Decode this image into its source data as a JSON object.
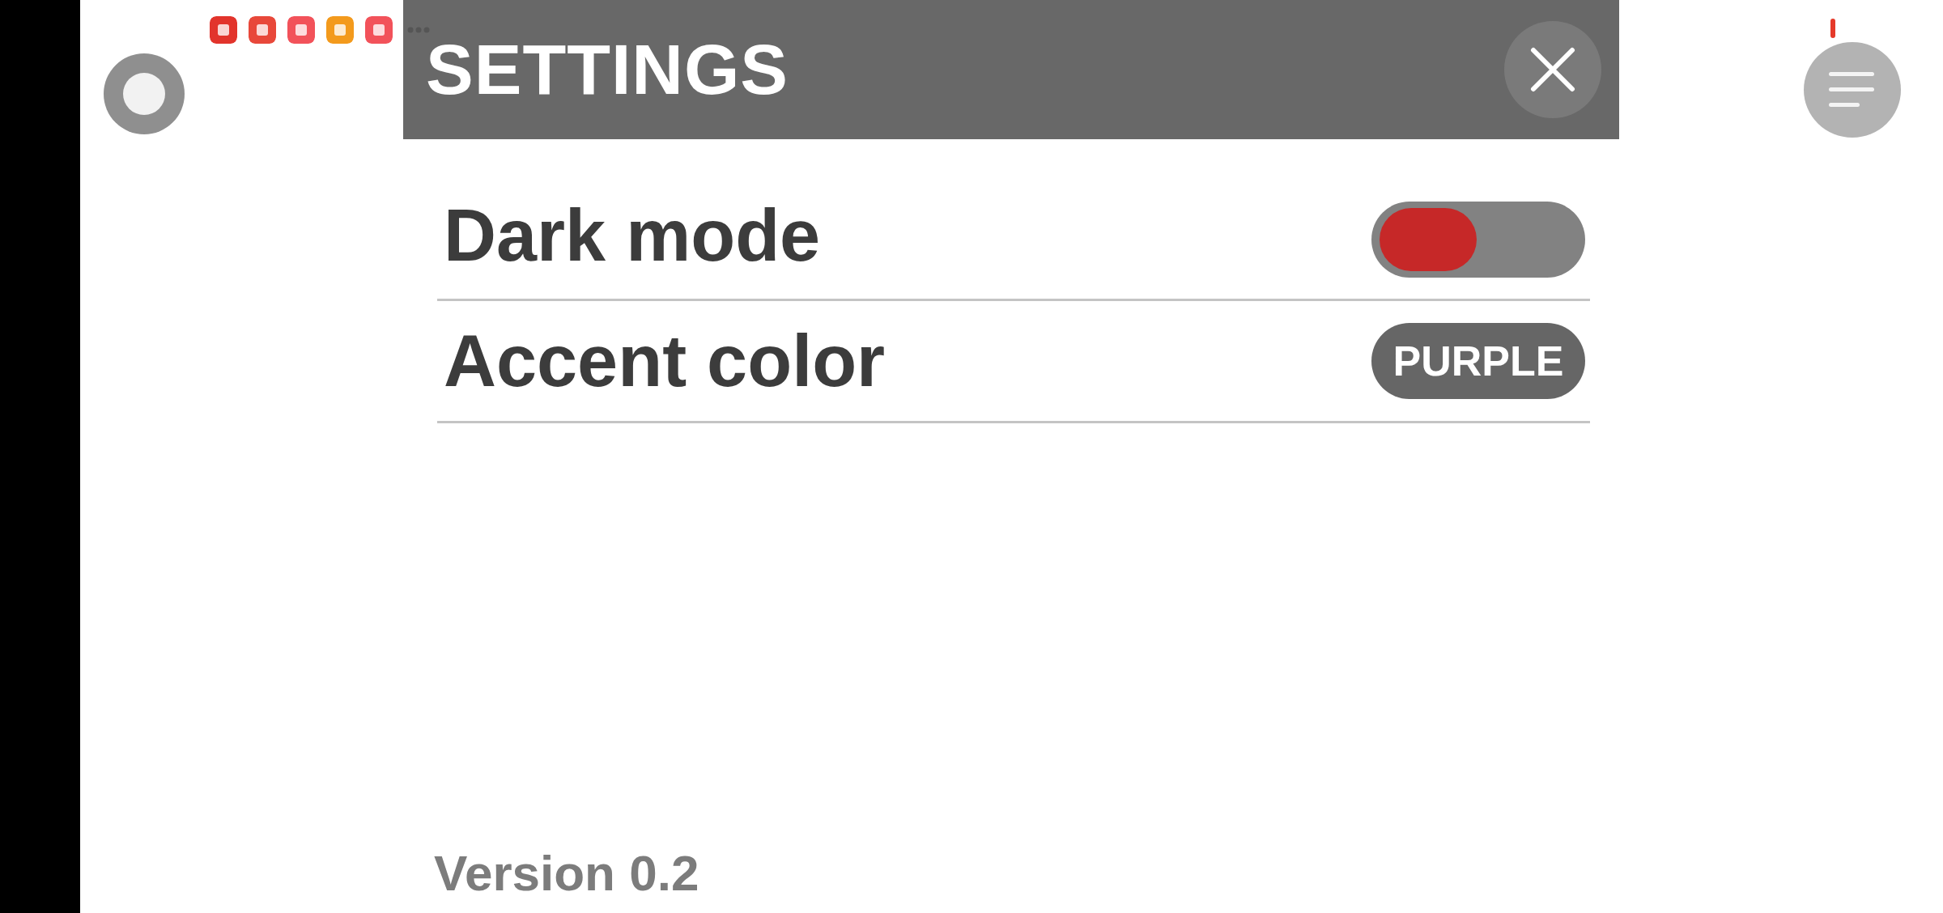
{
  "header": {
    "title": "SETTINGS"
  },
  "settings": [
    {
      "kind": "toggle",
      "label": "Dark mode",
      "on": false
    },
    {
      "kind": "button",
      "label": "Accent color",
      "value": "PURPLE"
    }
  ],
  "footer": {
    "version": "Version 0.2"
  }
}
